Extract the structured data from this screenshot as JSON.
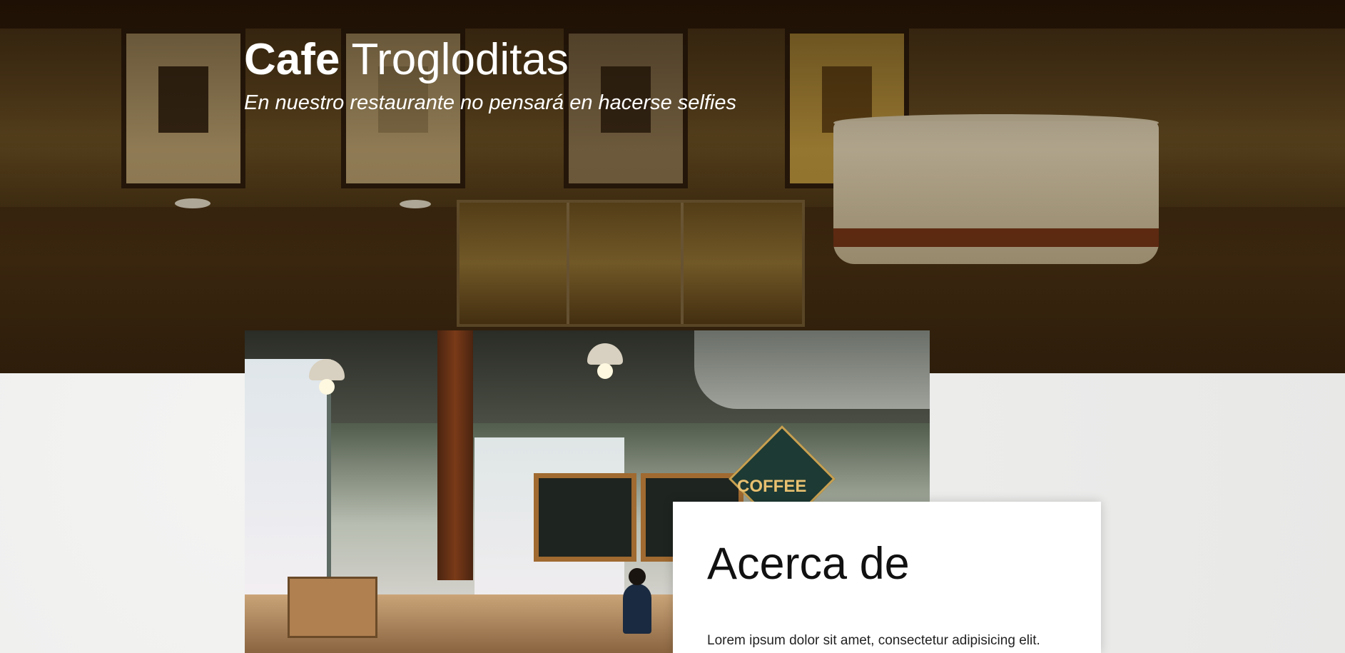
{
  "hero": {
    "title_bold": "Cafe",
    "title_rest": "Trogloditas",
    "subtitle": "En nuestro restaurante no pensará en hacerse selfies"
  },
  "about": {
    "heading": "Acerca de",
    "text": "Lorem ipsum dolor sit amet, consectetur adipisicing elit."
  },
  "photo": {
    "sign_text": "COFFEE"
  },
  "colors": {
    "hero_overlay": "#2a1809",
    "page_background": "#efefee",
    "card_background": "#ffffff",
    "heading_text": "#111111"
  }
}
